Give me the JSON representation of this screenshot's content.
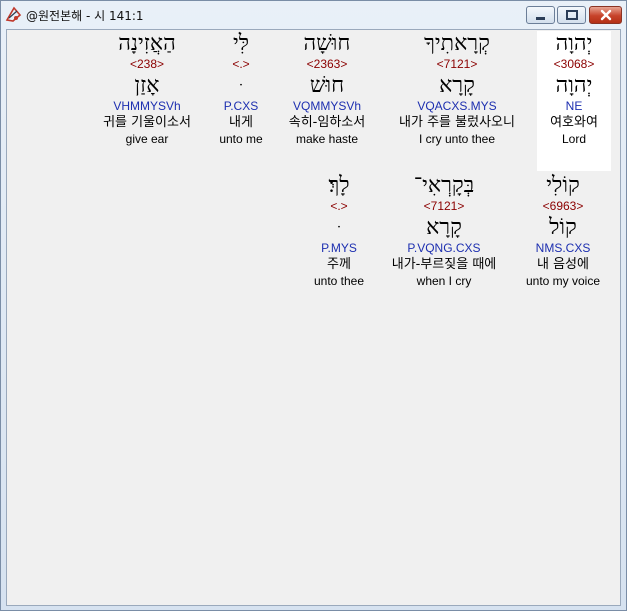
{
  "window": {
    "title": "@원전본해 - 시 141:1"
  },
  "words": [
    {
      "hebrew": "יְהוָה",
      "strong": "<3068>",
      "lexeme": "יְהוָה",
      "morph": "NE",
      "korean": "여호와여",
      "english": "Lord"
    },
    {
      "hebrew": "קְרָאתִיךָ",
      "strong": "<7121>",
      "lexeme": "קָרָא",
      "morph": "VQACXS.MYS",
      "korean": "내가 주를 불렀사오니",
      "english": "I cry unto thee"
    },
    {
      "hebrew": "חוּשָׁה",
      "strong": "<2363>",
      "lexeme": "חוּשׁ",
      "morph": "VQMMYSVh",
      "korean": "속히-임하소서",
      "english": "make haste"
    },
    {
      "hebrew": "לִּי",
      "strong": "<.>",
      "lexeme": "ּ",
      "morph": "P.CXS",
      "korean": "내게",
      "english": "unto me"
    },
    {
      "hebrew": "הַאֲזִינָה",
      "strong": "<238>",
      "lexeme": "אָזַן",
      "morph": "VHMMYSVh",
      "korean": "귀를 기울이소서",
      "english": "give ear"
    },
    {
      "hebrew": "קוֹלִי",
      "strong": "<6963>",
      "lexeme": "קוֹל",
      "morph": "NMS.CXS",
      "korean": "내 음성에",
      "english": "unto my voice"
    },
    {
      "hebrew": "בְּקָרְאִי־",
      "strong": "<7121>",
      "lexeme": "קָרָא",
      "morph": "P.VQNG.CXS",
      "korean": "내가-부르짖을 때에",
      "english": "when I cry"
    },
    {
      "hebrew": "לָךְ׃",
      "strong": "<.>",
      "lexeme": "ּ",
      "morph": "P.MYS",
      "korean": "주께",
      "english": "unto thee"
    }
  ]
}
